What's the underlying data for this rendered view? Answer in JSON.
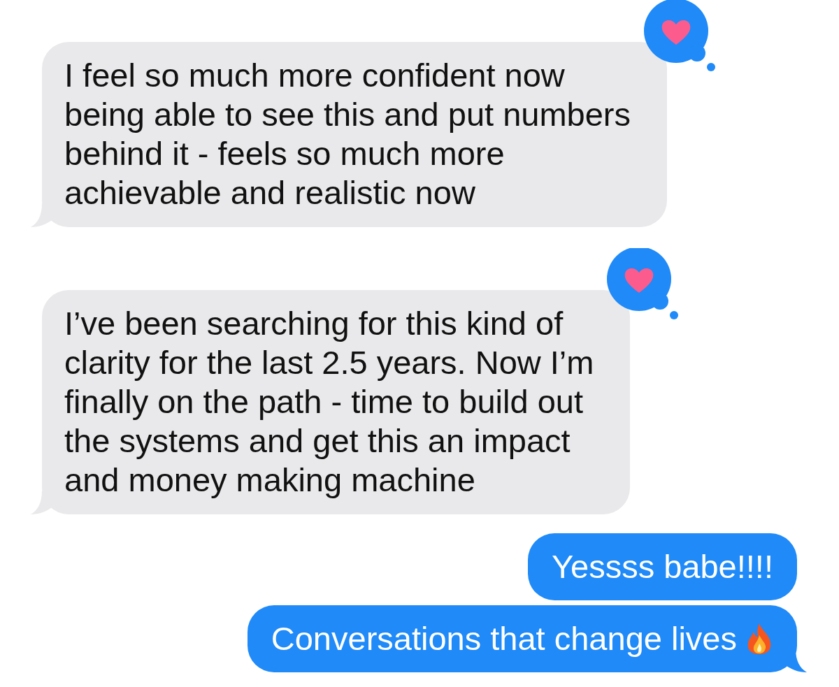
{
  "messages": [
    {
      "sent": false,
      "lines": [
        "I feel so much more confident now",
        "being able to see this and put numbers",
        "behind it - feels so much more",
        "achievable and realistic now"
      ],
      "heart_reaction": true
    },
    {
      "sent": false,
      "lines": [
        "I’ve been searching for this kind of",
        "clarity for the last 2.5 years. Now I’m",
        "finally on the path - time to build out",
        "the systems and get this an impact",
        "and money making machine"
      ],
      "heart_reaction": true
    },
    {
      "sent": true,
      "lines": [
        "Yessss babe!!!!"
      ],
      "tail": false
    },
    {
      "sent": true,
      "lines": [
        "Conversations that change lives"
      ],
      "fire_emoji": true,
      "tail": true
    }
  ]
}
